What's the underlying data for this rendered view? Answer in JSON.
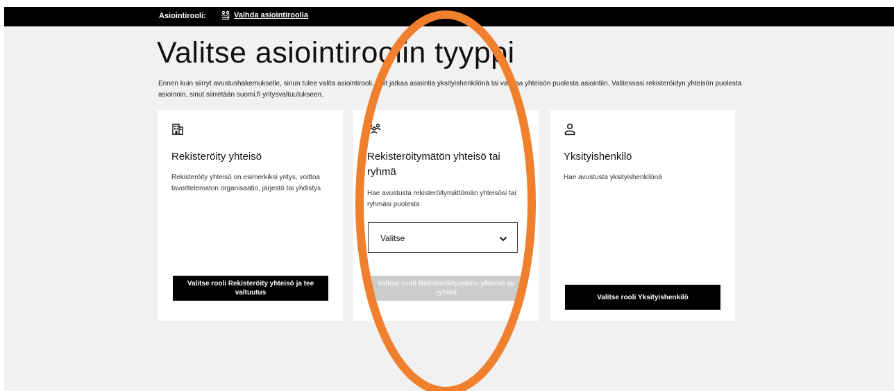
{
  "topbar": {
    "role_label": "Asiointirooli:",
    "switch_link": "Vaihda asiointiroolia"
  },
  "page": {
    "title": "Valitse asiointiroolin tyyppi",
    "intro": "Ennen kuin siirryt avustushakemukselle, sinun tulee valita asiointirooli. Voit jatkaa asiointia yksityishenkilönä tai vaihtaa yhteisön puolesta asiointiin. Valitessasi rekisteröidyn yhteisön puolesta asioinnin, sinut siirretään suomi.fi yritysvaltuutukseen."
  },
  "cards": {
    "registered": {
      "icon": "building-icon",
      "title": "Rekisteröity yhteisö",
      "description": "Rekisteröity yhteisö on esimerkiksi yritys, voittoa tavoittelematon organisaatio, järjestö tai yhdistys",
      "button": "Valitse rooli Rekisteröity yhteisö ja tee valtuutus"
    },
    "unregistered": {
      "icon": "group-icon",
      "title": "Rekisteröitymätön yhteisö tai ryhmä",
      "description": "Hae avustusta rekisteröitymättömän yhteisösi tai ryhmäsi puolesta",
      "select_value": "Valitse",
      "button": "Valitse rooli Rekisteröitymätön yhteisö tai ryhmä"
    },
    "private": {
      "icon": "person-icon",
      "title": "Yksityishenkilö",
      "description": "Hae avustusta yksityishenkilönä",
      "button": "Valitse rooli Yksityishenkilö"
    }
  },
  "colors": {
    "annotation": "#f07f2e",
    "disabled_button": "#cccccc"
  }
}
